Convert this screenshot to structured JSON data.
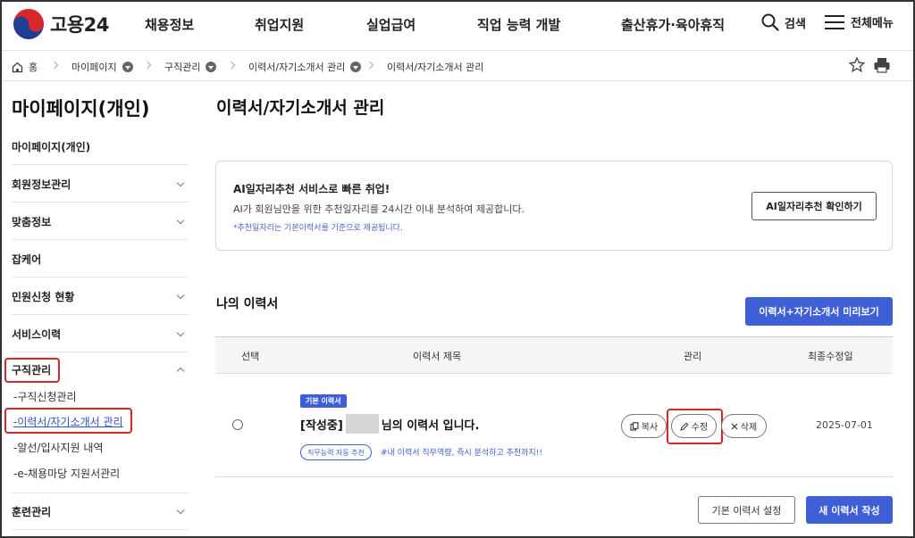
{
  "header": {
    "logo_text": "고용24",
    "nav": [
      "채용정보",
      "취업지원",
      "실업급여",
      "직업 능력 개발",
      "출산휴가·육아휴직"
    ],
    "search_label": "검색",
    "menu_label": "전체메뉴"
  },
  "breadcrumb": [
    "홈",
    "마이페이지",
    "구직관리",
    "이력서/자기소개서 관리",
    "이력서/자기소개서 관리"
  ],
  "sidebar": {
    "title": "마이페이지(개인)",
    "items": [
      {
        "label": "마이페이지(개인)"
      },
      {
        "label": "회원정보관리"
      },
      {
        "label": "맞춤정보"
      },
      {
        "label": "잡케어"
      },
      {
        "label": "민원신청 현황"
      },
      {
        "label": "서비스이력"
      },
      {
        "label": "구직관리"
      },
      {
        "label": "훈련관리"
      }
    ],
    "subitems": [
      "-구직신청관리",
      "-이력서/자기소개서 관리",
      "-알선/입사지원 내역",
      "-e-채용마당 지원서관리"
    ]
  },
  "main": {
    "title": "이력서/자기소개서 관리",
    "ai_box": {
      "heading": "AI일자리추천 서비스로 빠른 취업!",
      "desc": "AI가 회원님만을 위한 추천일자리를 24시간 이내 분석하여 제공합니다.",
      "note": "*추천일자리는 기본이력서를 기준으로 제공됩니다.",
      "button": "AI일자리추천 확인하기"
    },
    "section_title": "나의 이력서",
    "preview_button": "이력서+자기소개서 미리보기",
    "table": {
      "headers": [
        "선택",
        "이력서 제목",
        "관리",
        "최종수정일"
      ],
      "row": {
        "badge": "기본 이력서",
        "title_prefix": "[작성중]",
        "title_suffix": "님의 이력서 입니다.",
        "tag": "직무능력 자동 추천",
        "tag_desc": "#내 이력서 직무역량, 즉시 분석하고 추천까지!!",
        "actions": {
          "copy": "복사",
          "edit": "수정",
          "delete": "삭제"
        },
        "date": "2025-07-01"
      }
    },
    "btn_set_default": "기본 이력서 설정",
    "btn_new": "새 이력서 작성"
  },
  "colors": {
    "accent": "#3f5fd6",
    "highlight": "#d5262b",
    "link": "#2f56c9"
  }
}
